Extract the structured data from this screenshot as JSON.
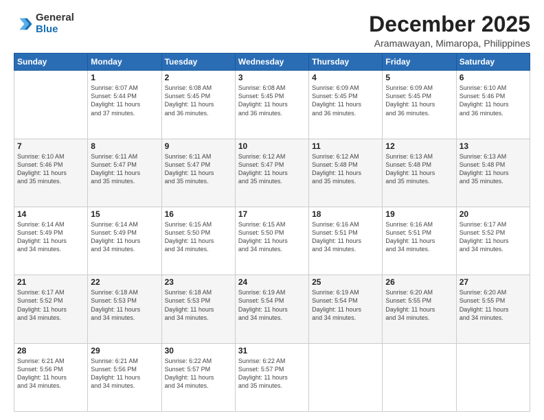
{
  "logo": {
    "general": "General",
    "blue": "Blue"
  },
  "header": {
    "title": "December 2025",
    "subtitle": "Aramawayan, Mimaropa, Philippines"
  },
  "weekdays": [
    "Sunday",
    "Monday",
    "Tuesday",
    "Wednesday",
    "Thursday",
    "Friday",
    "Saturday"
  ],
  "weeks": [
    [
      {
        "day": "",
        "info": ""
      },
      {
        "day": "1",
        "info": "Sunrise: 6:07 AM\nSunset: 5:44 PM\nDaylight: 11 hours\nand 37 minutes."
      },
      {
        "day": "2",
        "info": "Sunrise: 6:08 AM\nSunset: 5:45 PM\nDaylight: 11 hours\nand 36 minutes."
      },
      {
        "day": "3",
        "info": "Sunrise: 6:08 AM\nSunset: 5:45 PM\nDaylight: 11 hours\nand 36 minutes."
      },
      {
        "day": "4",
        "info": "Sunrise: 6:09 AM\nSunset: 5:45 PM\nDaylight: 11 hours\nand 36 minutes."
      },
      {
        "day": "5",
        "info": "Sunrise: 6:09 AM\nSunset: 5:45 PM\nDaylight: 11 hours\nand 36 minutes."
      },
      {
        "day": "6",
        "info": "Sunrise: 6:10 AM\nSunset: 5:46 PM\nDaylight: 11 hours\nand 36 minutes."
      }
    ],
    [
      {
        "day": "7",
        "info": "Sunrise: 6:10 AM\nSunset: 5:46 PM\nDaylight: 11 hours\nand 35 minutes."
      },
      {
        "day": "8",
        "info": "Sunrise: 6:11 AM\nSunset: 5:47 PM\nDaylight: 11 hours\nand 35 minutes."
      },
      {
        "day": "9",
        "info": "Sunrise: 6:11 AM\nSunset: 5:47 PM\nDaylight: 11 hours\nand 35 minutes."
      },
      {
        "day": "10",
        "info": "Sunrise: 6:12 AM\nSunset: 5:47 PM\nDaylight: 11 hours\nand 35 minutes."
      },
      {
        "day": "11",
        "info": "Sunrise: 6:12 AM\nSunset: 5:48 PM\nDaylight: 11 hours\nand 35 minutes."
      },
      {
        "day": "12",
        "info": "Sunrise: 6:13 AM\nSunset: 5:48 PM\nDaylight: 11 hours\nand 35 minutes."
      },
      {
        "day": "13",
        "info": "Sunrise: 6:13 AM\nSunset: 5:48 PM\nDaylight: 11 hours\nand 35 minutes."
      }
    ],
    [
      {
        "day": "14",
        "info": "Sunrise: 6:14 AM\nSunset: 5:49 PM\nDaylight: 11 hours\nand 34 minutes."
      },
      {
        "day": "15",
        "info": "Sunrise: 6:14 AM\nSunset: 5:49 PM\nDaylight: 11 hours\nand 34 minutes."
      },
      {
        "day": "16",
        "info": "Sunrise: 6:15 AM\nSunset: 5:50 PM\nDaylight: 11 hours\nand 34 minutes."
      },
      {
        "day": "17",
        "info": "Sunrise: 6:15 AM\nSunset: 5:50 PM\nDaylight: 11 hours\nand 34 minutes."
      },
      {
        "day": "18",
        "info": "Sunrise: 6:16 AM\nSunset: 5:51 PM\nDaylight: 11 hours\nand 34 minutes."
      },
      {
        "day": "19",
        "info": "Sunrise: 6:16 AM\nSunset: 5:51 PM\nDaylight: 11 hours\nand 34 minutes."
      },
      {
        "day": "20",
        "info": "Sunrise: 6:17 AM\nSunset: 5:52 PM\nDaylight: 11 hours\nand 34 minutes."
      }
    ],
    [
      {
        "day": "21",
        "info": "Sunrise: 6:17 AM\nSunset: 5:52 PM\nDaylight: 11 hours\nand 34 minutes."
      },
      {
        "day": "22",
        "info": "Sunrise: 6:18 AM\nSunset: 5:53 PM\nDaylight: 11 hours\nand 34 minutes."
      },
      {
        "day": "23",
        "info": "Sunrise: 6:18 AM\nSunset: 5:53 PM\nDaylight: 11 hours\nand 34 minutes."
      },
      {
        "day": "24",
        "info": "Sunrise: 6:19 AM\nSunset: 5:54 PM\nDaylight: 11 hours\nand 34 minutes."
      },
      {
        "day": "25",
        "info": "Sunrise: 6:19 AM\nSunset: 5:54 PM\nDaylight: 11 hours\nand 34 minutes."
      },
      {
        "day": "26",
        "info": "Sunrise: 6:20 AM\nSunset: 5:55 PM\nDaylight: 11 hours\nand 34 minutes."
      },
      {
        "day": "27",
        "info": "Sunrise: 6:20 AM\nSunset: 5:55 PM\nDaylight: 11 hours\nand 34 minutes."
      }
    ],
    [
      {
        "day": "28",
        "info": "Sunrise: 6:21 AM\nSunset: 5:56 PM\nDaylight: 11 hours\nand 34 minutes."
      },
      {
        "day": "29",
        "info": "Sunrise: 6:21 AM\nSunset: 5:56 PM\nDaylight: 11 hours\nand 34 minutes."
      },
      {
        "day": "30",
        "info": "Sunrise: 6:22 AM\nSunset: 5:57 PM\nDaylight: 11 hours\nand 34 minutes."
      },
      {
        "day": "31",
        "info": "Sunrise: 6:22 AM\nSunset: 5:57 PM\nDaylight: 11 hours\nand 35 minutes."
      },
      {
        "day": "",
        "info": ""
      },
      {
        "day": "",
        "info": ""
      },
      {
        "day": "",
        "info": ""
      }
    ]
  ]
}
